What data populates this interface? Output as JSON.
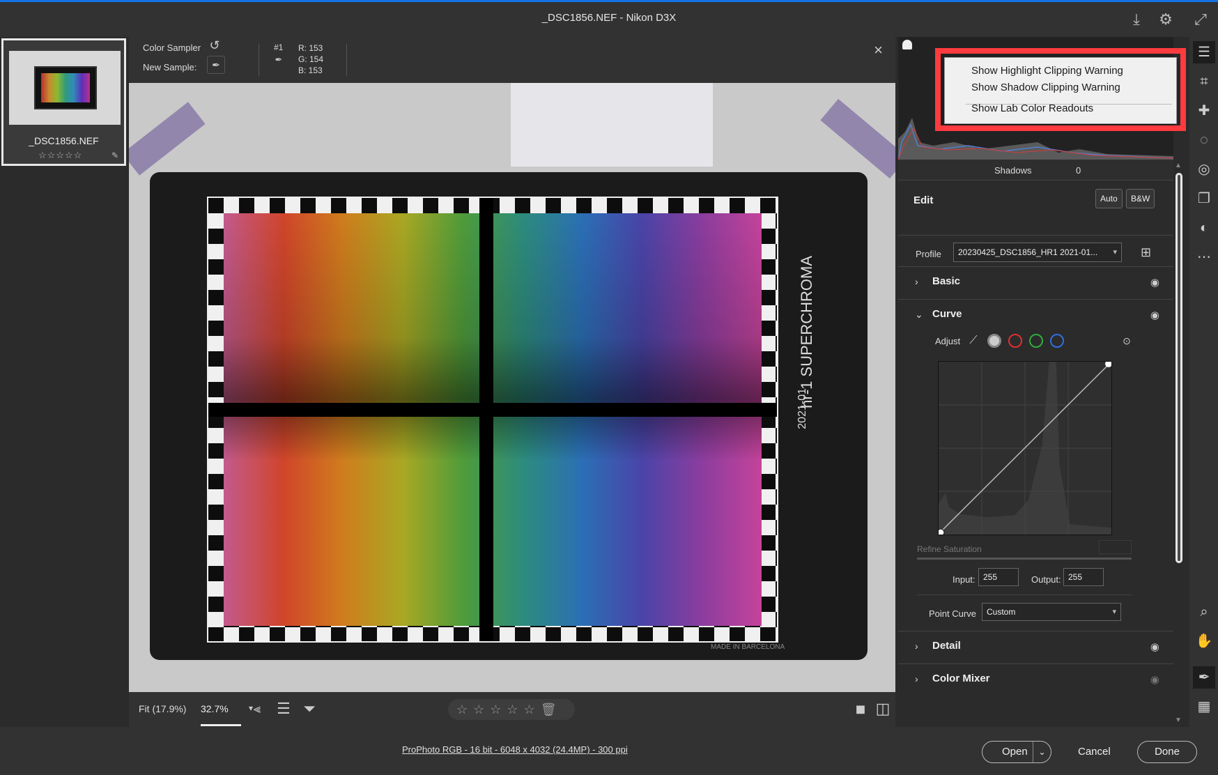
{
  "window": {
    "title": "_DSC1856.NEF  -  Nikon D3X",
    "icons": [
      "save-icon",
      "gear-icon",
      "expand-icon"
    ]
  },
  "filmstrip": {
    "filename": "_DSC1856.NEF",
    "rating": "☆☆☆☆☆"
  },
  "sampler": {
    "title": "Color Sampler",
    "new_sample_label": "New Sample:",
    "sample_id": "#1",
    "r": "R:  153",
    "g": "G:  154",
    "b": "B:  153"
  },
  "viewbar": {
    "fit": "Fit (17.9%)",
    "zoom": "32.7%",
    "stars": "☆☆☆☆☆"
  },
  "status": {
    "info": "ProPhoto RGB - 16 bit - 6048 x 4032 (24.4MP) - 300 ppi",
    "open": "Open",
    "cancel": "Cancel",
    "done": "Done"
  },
  "histogram": {
    "shadows_label": "Shadows",
    "shadows_value": "0"
  },
  "edit": {
    "title": "Edit",
    "auto": "Auto",
    "bw": "B&W",
    "profile_label": "Profile",
    "profile_value": "20230425_DSC1856_HR1 2021-01...",
    "sections": {
      "basic": "Basic",
      "curve": "Curve",
      "detail": "Detail",
      "color_mixer": "Color Mixer"
    },
    "curve": {
      "adjust_label": "Adjust",
      "refine": "Refine Saturation",
      "input_label": "Input:",
      "input_value": "255",
      "output_label": "Output:",
      "output_value": "255",
      "point_curve_label": "Point Curve",
      "point_curve_value": "Custom"
    }
  },
  "context_menu": {
    "items": [
      "Show Highlight Clipping Warning",
      "Show Shadow Clipping Warning",
      "Show Lab Color Readouts"
    ]
  },
  "target_labels": {
    "brand": "hr-1 SUPERCHROMA",
    "date": "2021-01",
    "made": "MADE IN BARCELONA"
  },
  "colors": {
    "accent": "#1473e6",
    "highlight": "#ff3b3f",
    "red": "#e03030",
    "green": "#2fae3c",
    "blue": "#2f6fe0"
  }
}
